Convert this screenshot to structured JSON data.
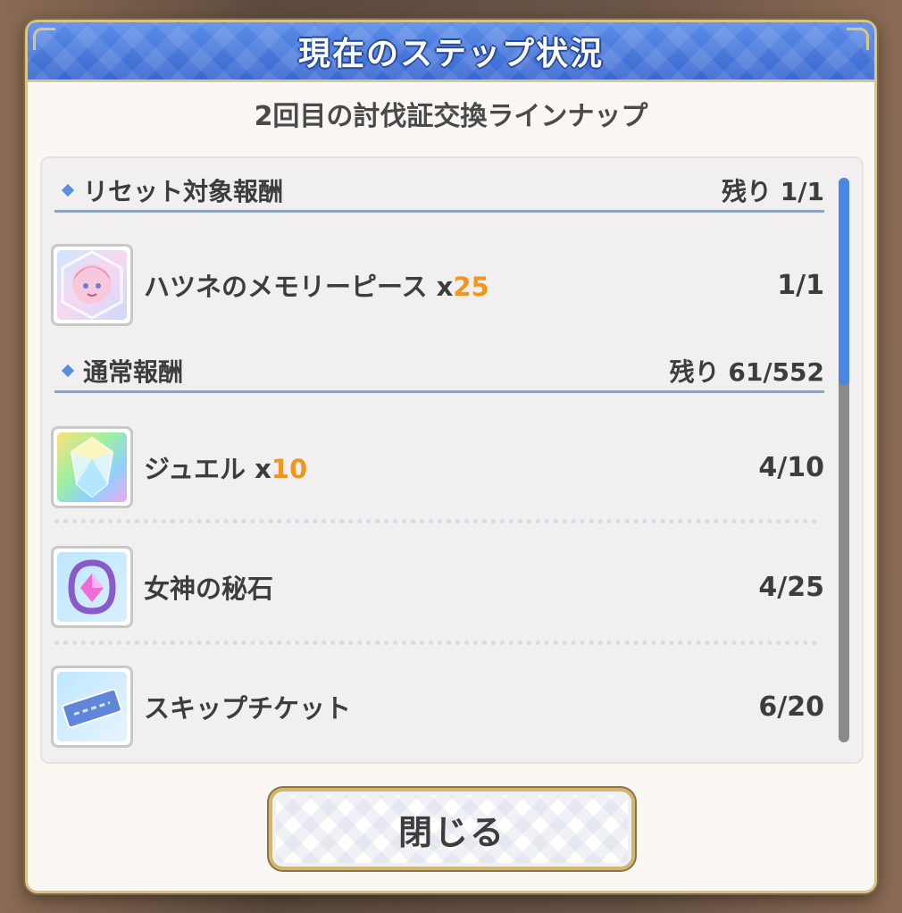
{
  "dialog": {
    "title": "現在のステップ状況",
    "subtitle": "2回目の討伐証交換ラインナップ",
    "close_label": "閉じる"
  },
  "sections": [
    {
      "header": "リセット対象報酬",
      "remaining": "残り 1/1",
      "items": [
        {
          "name": "ハツネのメモリーピース ",
          "qty_prefix": "x",
          "qty": "25",
          "count": "1/1",
          "icon": "hatsune-memory-piece-icon"
        }
      ]
    },
    {
      "header": "通常報酬",
      "remaining": "残り 61/552",
      "items": [
        {
          "name": "ジュエル ",
          "qty_prefix": "x",
          "qty": "10",
          "count": "4/10",
          "icon": "jewel-icon"
        },
        {
          "name": "女神の秘石",
          "count": "4/25",
          "icon": "goddess-stone-icon"
        },
        {
          "name": "スキップチケット",
          "count": "6/20",
          "icon": "skip-ticket-icon"
        }
      ]
    }
  ],
  "colors": {
    "title_bar": "#3a67cf",
    "accent_gold": "#d9c48a",
    "quantity": "#f0961e",
    "scroll_thumb": "#4a86e3"
  }
}
